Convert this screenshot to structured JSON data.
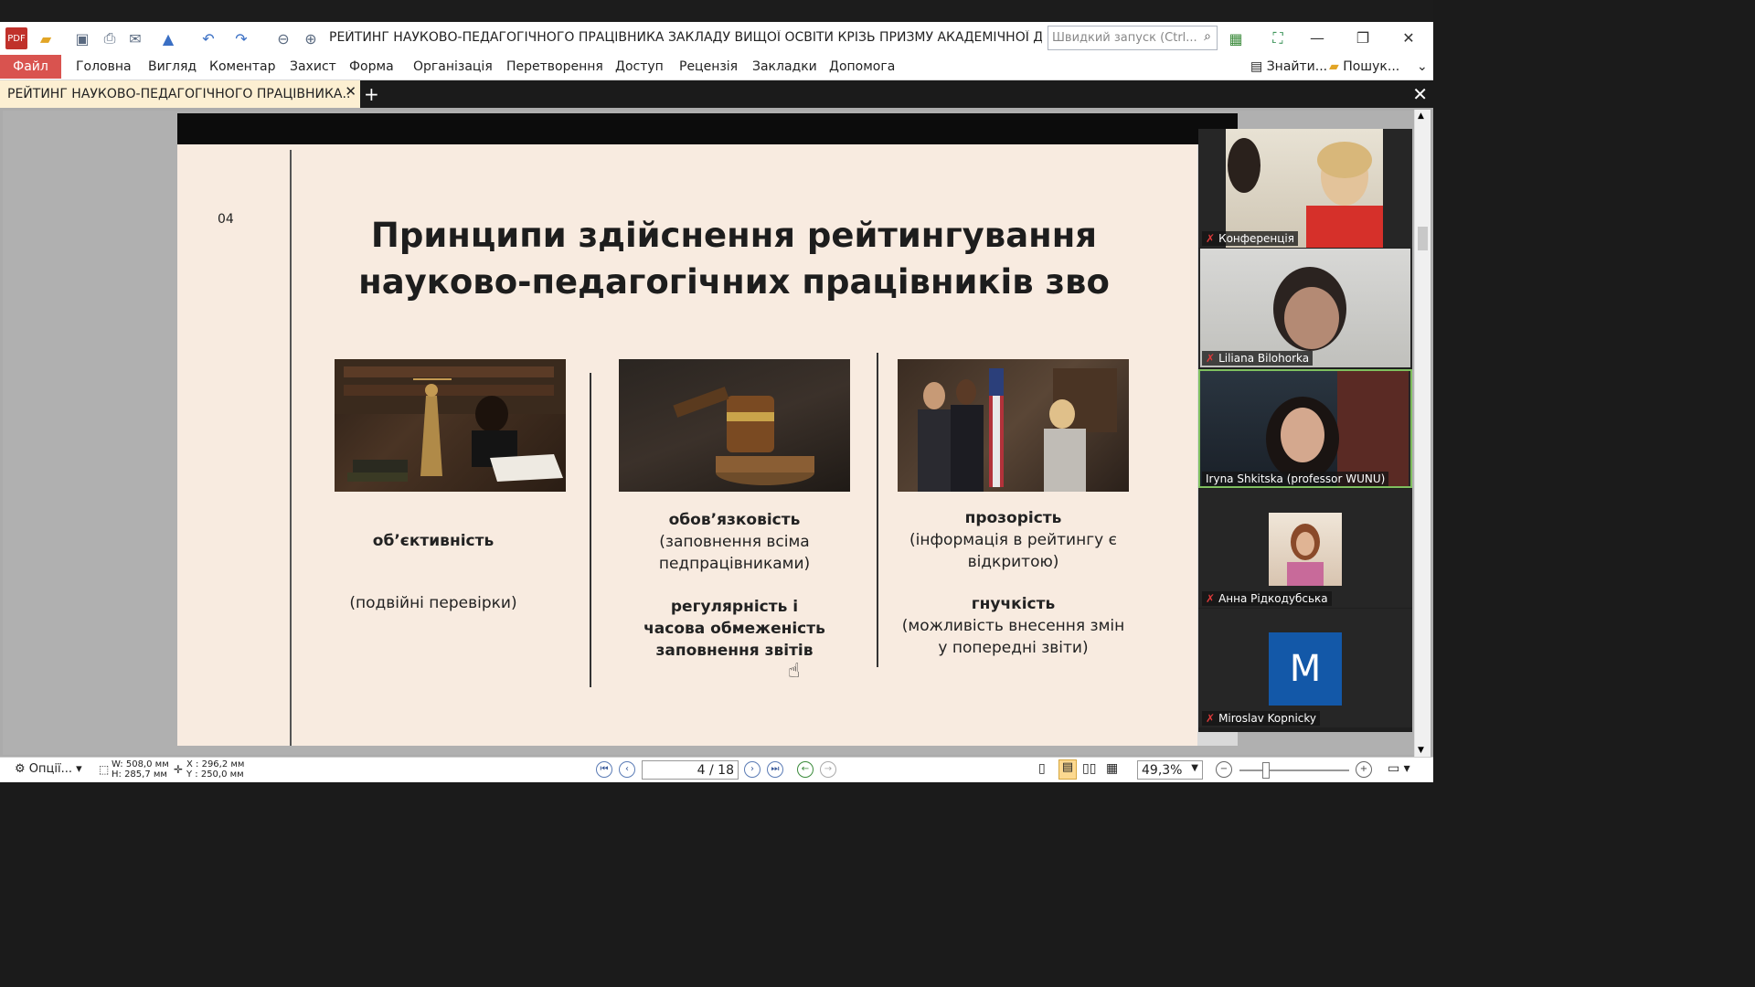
{
  "window": {
    "title": "РЕЙТИНГ НАУКОВО-ПЕДАГОГІЧНОГО ПРАЦІВНИКА ЗАКЛАДУ ВИЩОЇ ОСВІТИ КРІЗЬ ПРИЗМУ АКАДЕМІЧНОЇ ДОБР..",
    "search_placeholder": "Швидкий запуск (Ctrl..."
  },
  "menu": {
    "file": "Файл",
    "items": [
      "Головна",
      "Вигляд",
      "Коментар",
      "Захист",
      "Форма",
      "Організація",
      "Перетворення",
      "Доступ",
      "Рецензія",
      "Закладки",
      "Допомога"
    ],
    "find": "Знайти...",
    "search": "Пошук..."
  },
  "tab": {
    "label": "РЕЙТИНГ НАУКОВО-ПЕДАГОГІЧНОГО ПРАЦІВНИКА..",
    "close": "✕",
    "new": "+"
  },
  "slide": {
    "number": "04",
    "title_line1": "Принципи здійснення рейтингування",
    "title_line2": "науково-педагогічних працівників зво",
    "col1": {
      "bold": "об’єктивність",
      "text": "(подвійні перевірки)"
    },
    "col2": {
      "bold1": "обов’язковість",
      "text1a": "(заповнення всіма",
      "text1b": "педпрацівниками)",
      "bold2a": "регулярність і",
      "bold2b": "часова обмеженість",
      "bold2c": "заповнення звітів"
    },
    "col3": {
      "bold1": "прозорість",
      "text1a": "(інформація в рейтингу є",
      "text1b": "відкритою)",
      "bold2": "гнучкість",
      "text2a": "(можливість внесення змін",
      "text2b": "у попередні звіти)"
    }
  },
  "participants": [
    {
      "name": "Конференція",
      "muted": true
    },
    {
      "name": "Liliana Bilohorka",
      "muted": true
    },
    {
      "name": "Iryna Shkitska (professor WUNU)",
      "muted": false
    },
    {
      "name": "Анна Рідкодубська",
      "muted": true
    },
    {
      "name": "Miroslav Kopnicky",
      "muted": true,
      "initial": "M"
    }
  ],
  "status": {
    "options": "Опції...",
    "w": "W: 508,0 мм",
    "h": "H: 285,7 мм",
    "x": "X : 296,2 мм",
    "y": "Y : 250,0 мм",
    "page": "4 / 18",
    "zoom": "49,3%"
  },
  "colors": {
    "accent": "#d9534f",
    "slide_bg": "#f8ebe0",
    "tab_bg": "#fcefd2"
  }
}
